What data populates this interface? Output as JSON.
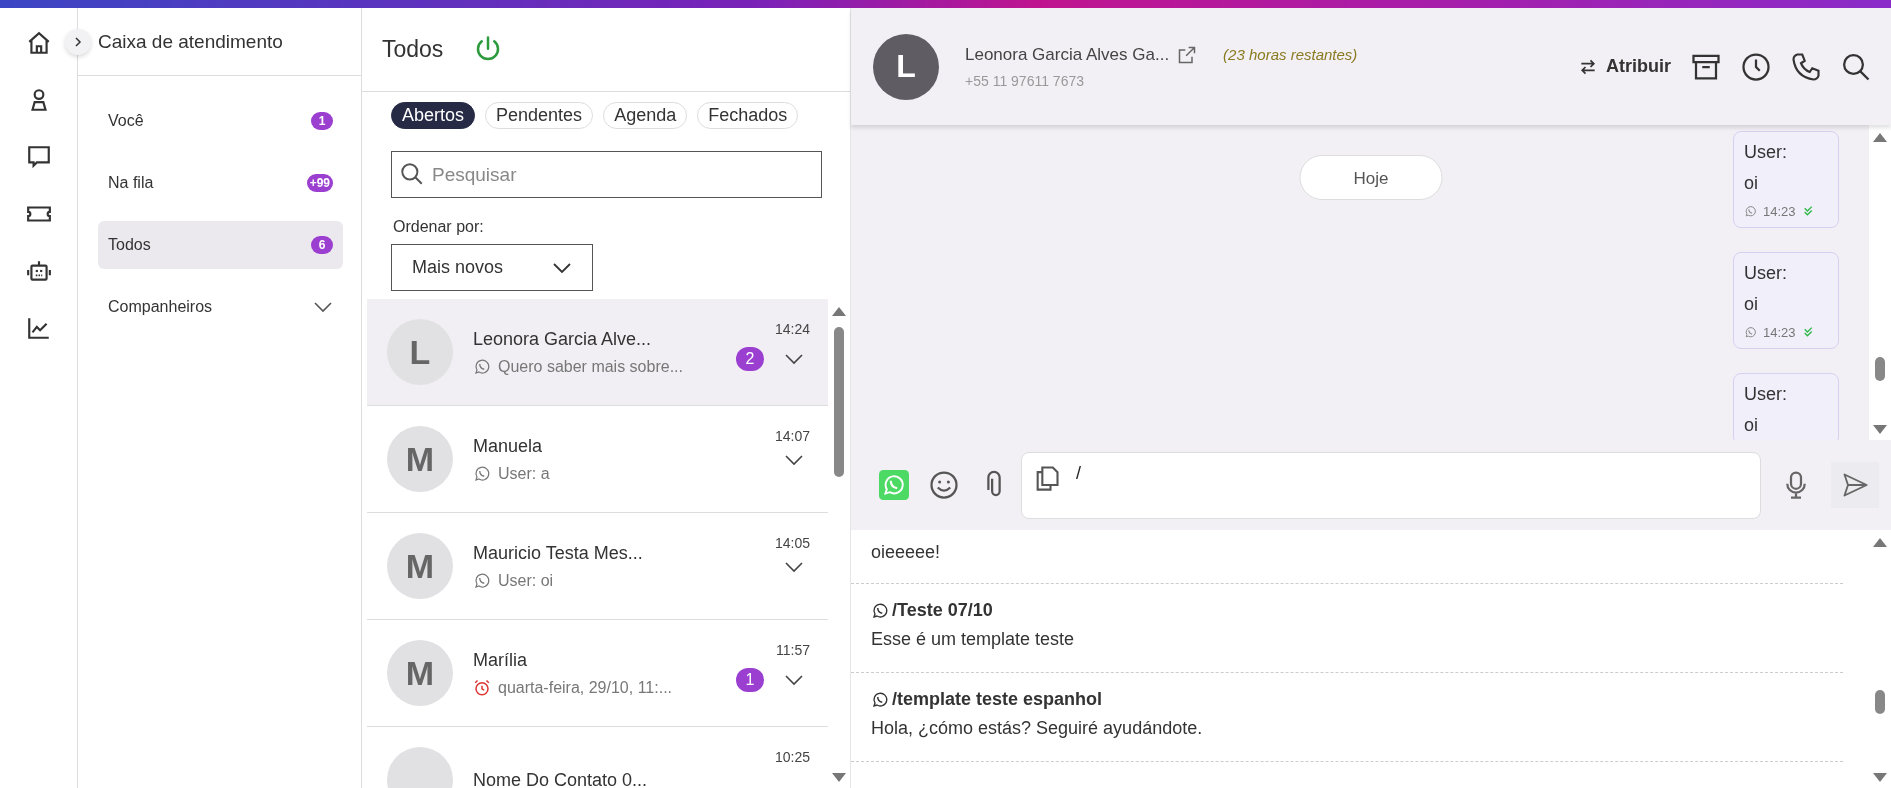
{
  "nav": {
    "title": "Caixa de atendimento",
    "items": [
      {
        "kind": "count",
        "label": "Você",
        "count": "1",
        "selected": false
      },
      {
        "kind": "count",
        "label": "Na fila",
        "count": "+99",
        "selected": false
      },
      {
        "kind": "count",
        "label": "Todos",
        "count": "6",
        "selected": true
      },
      {
        "kind": "group",
        "label": "Companheiros",
        "expanded": false
      }
    ]
  },
  "list": {
    "title": "Todos",
    "online": true,
    "filters": [
      {
        "label": "Abertos",
        "selected": true
      },
      {
        "label": "Pendentes",
        "selected": false
      },
      {
        "label": "Agenda",
        "selected": false
      },
      {
        "label": "Fechados",
        "selected": false
      }
    ],
    "search": {
      "placeholder": "Pesquisar"
    },
    "sort": {
      "label": "Ordenar por:",
      "value": "Mais novos"
    },
    "conversations": [
      {
        "initial": "L",
        "name": "Leonora Garcia Alve...",
        "kind": "whatsapp",
        "preview": "Quero saber mais sobre...",
        "time": "14:24",
        "unread": "2",
        "selected": true
      },
      {
        "initial": "M",
        "name": "Manuela",
        "kind": "whatsapp",
        "preview": "User: a",
        "time": "14:07",
        "selected": false
      },
      {
        "initial": "M",
        "name": "Mauricio Testa Mes...",
        "kind": "whatsapp",
        "preview": "User: oi",
        "time": "14:05",
        "selected": false
      },
      {
        "initial": "M",
        "name": "Marília",
        "kind": "scheduled",
        "preview": "quarta-feira, 29/10, 11:...",
        "time": "11:57",
        "unread": "1",
        "selected": false
      },
      {
        "name": "Nome Do Contato 0...",
        "time": "10:25",
        "selected": false
      }
    ]
  },
  "chat": {
    "contact": {
      "initial": "L",
      "name": "Leonora Garcia Alves Ga...",
      "phone": "+55 11 97611 7673",
      "note": "(23 horas restantes)"
    },
    "assign_label": "Atribuir",
    "day_label": "Hoje",
    "messages": [
      {
        "sender": "User:",
        "text": "oi",
        "time": "14:23",
        "read": true
      },
      {
        "sender": "User:",
        "text": "oi",
        "time": "14:23",
        "read": true
      },
      {
        "sender": "User:",
        "text": "oi"
      }
    ],
    "composer": {
      "value": "/"
    },
    "templates": [
      {
        "body": "oieeeee!"
      },
      {
        "title": "/Teste 07/10",
        "body": "Esse é um template teste"
      },
      {
        "title": "/template teste espanhol",
        "body": "Hola, ¿cómo estás? Seguiré ayudándote."
      }
    ]
  }
}
